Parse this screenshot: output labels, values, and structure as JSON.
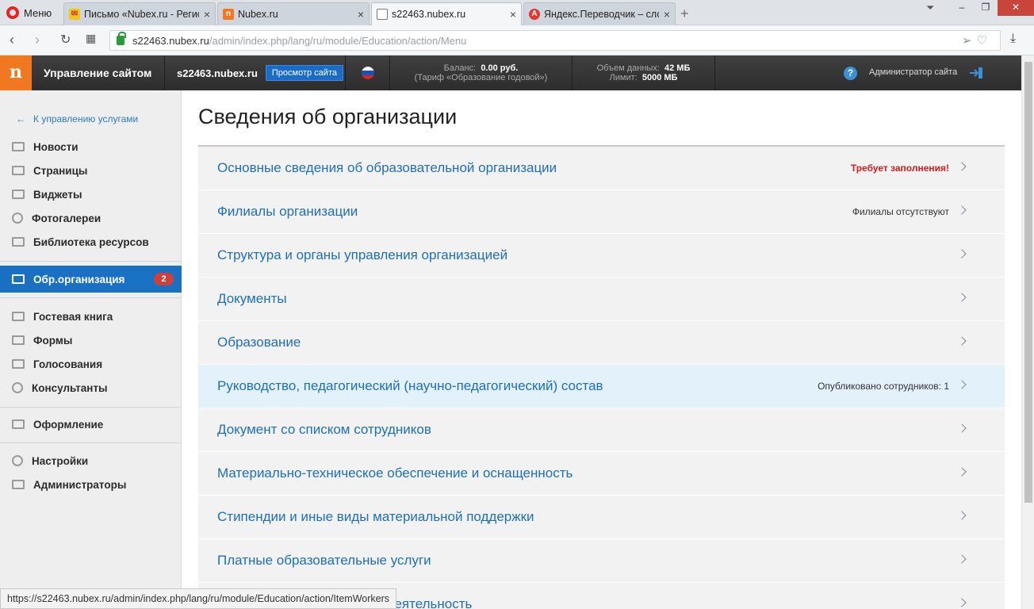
{
  "browser": {
    "menu_label": "Меню",
    "tabs": [
      {
        "title": "Письмо «Nubex.ru - Регис",
        "active": false
      },
      {
        "title": "Nubex.ru",
        "active": false
      },
      {
        "title": "s22463.nubex.ru",
        "active": true
      },
      {
        "title": "Яндекс.Переводчик – сло",
        "active": false
      }
    ],
    "url_host": "s22463.nubex.ru",
    "url_path": "/admin/index.php/lang/ru/module/Education/action/Menu"
  },
  "cms": {
    "logo": "n",
    "site_title": "Управление сайтом",
    "domain": "s22463.nubex.ru",
    "preview_button": "Просмотр сайта",
    "balance_label": "Баланс:",
    "balance_value": "0.00 руб.",
    "tariff": "(Тариф «Образование годовой»)",
    "quota_label": "Объем данных:",
    "quota_value": "42 МБ",
    "limit_label": "Лимит:",
    "limit_value": "5000 МБ",
    "help": "?",
    "admin_label": "Администратор сайта"
  },
  "sidebar": {
    "back_link": "К управлению услугами",
    "items": [
      {
        "label": "Новости"
      },
      {
        "label": "Страницы"
      },
      {
        "label": "Виджеты"
      },
      {
        "label": "Фотогалереи"
      },
      {
        "label": "Библиотека ресурсов"
      },
      {
        "label": "Обр.организация",
        "badge": "2",
        "active": true
      },
      {
        "label": "Гостевая книга"
      },
      {
        "label": "Формы"
      },
      {
        "label": "Голосования"
      },
      {
        "label": "Консультанты"
      },
      {
        "label": "Оформление"
      },
      {
        "label": "Настройки"
      },
      {
        "label": "Администраторы"
      }
    ]
  },
  "main": {
    "title": "Сведения об организации",
    "rows": [
      {
        "label": "Основные сведения об образовательной организации",
        "status": "Требует заполнения!"
      },
      {
        "label": "Филиалы организации",
        "status": "Филиалы отсутствуют"
      },
      {
        "label": "Структура и органы управления организацией",
        "status": ""
      },
      {
        "label": "Документы",
        "status": ""
      },
      {
        "label": "Образование",
        "status": ""
      },
      {
        "label": "Руководство, педагогический (научно-педагогический) состав",
        "status": "Опубликовано сотрудников: 1"
      },
      {
        "label": "Документ со списком сотрудников",
        "status": ""
      },
      {
        "label": "Материально-техническое обеспечение и оснащенность",
        "status": ""
      },
      {
        "label": "Стипендии и иные виды материальной поддержки",
        "status": ""
      },
      {
        "label": "Платные образовательные услуги",
        "status": ""
      },
      {
        "label": "Финансово-хозяйственная деятельность",
        "status": ""
      }
    ]
  },
  "statusbar": {
    "url": "https://s22463.nubex.ru/admin/index.php/lang/ru/module/Education/action/ItemWorkers"
  },
  "colors": {
    "accent": "#1a71c4",
    "logo": "#f07820",
    "link": "#1f6fb5",
    "warning": "#cc1f1f",
    "badge": "#d0403a"
  }
}
